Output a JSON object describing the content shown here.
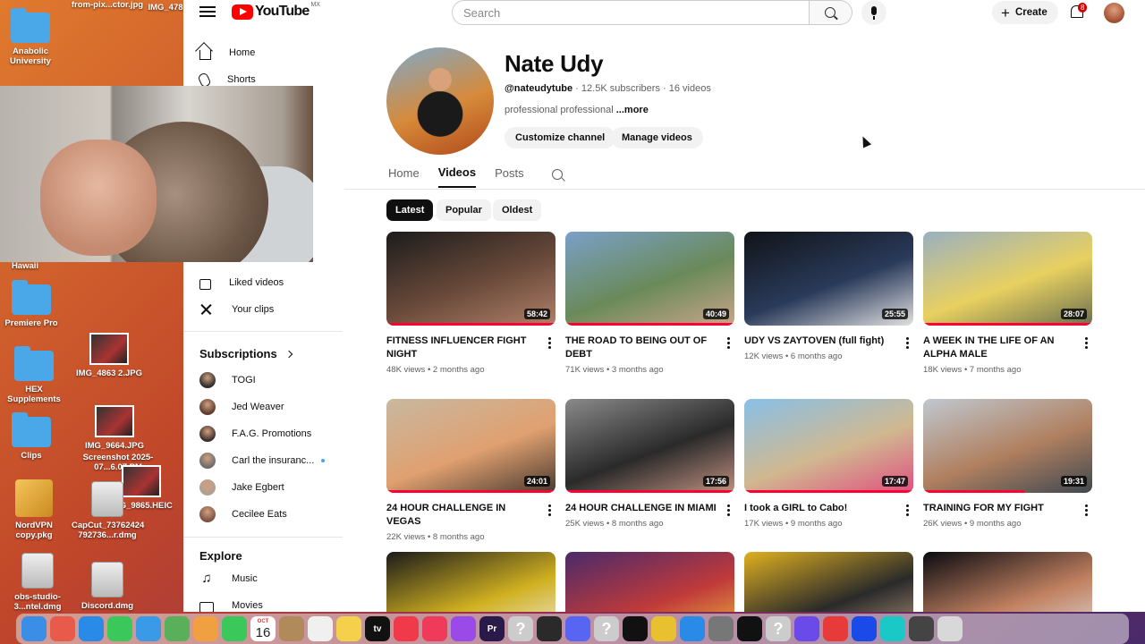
{
  "desktop": {
    "icons": [
      {
        "label": "from-pix...ctor.jpg",
        "kind": "photo"
      },
      {
        "label": "IMG_478",
        "kind": "photo"
      },
      {
        "label": "Anabolic University",
        "kind": "folder"
      },
      {
        "label": "Hawaii",
        "kind": "folder"
      },
      {
        "label": "Premiere Pro",
        "kind": "folder"
      },
      {
        "label": "IMG_4863 2.JPG",
        "kind": "photo"
      },
      {
        "label": "HEX Supplements",
        "kind": "folder"
      },
      {
        "label": "IMG_9664.JPG",
        "kind": "photo"
      },
      {
        "label": "Clips",
        "kind": "folder"
      },
      {
        "label": "Screenshot 2025-07...6.07 PM",
        "kind": "photo"
      },
      {
        "label": "IMG_9865.HEIC",
        "kind": "photo"
      },
      {
        "label": "NordVPN copy.pkg",
        "kind": "pkg"
      },
      {
        "label": "CapCut_73762424 792736...r.dmg",
        "kind": "disk"
      },
      {
        "label": "obs-studio-3...ntel.dmg",
        "kind": "disk"
      },
      {
        "label": "Discord.dmg",
        "kind": "disk"
      }
    ],
    "background_colors": [
      "#e07a2e",
      "#c0462a",
      "#8a2c52",
      "#4a2a6a"
    ]
  },
  "topbar": {
    "logo_text": "YouTube",
    "country_code": "MX",
    "search_placeholder": "Search",
    "create_label": "Create",
    "notification_count": "8"
  },
  "sidebar": {
    "items": [
      {
        "label": "Home",
        "icon": "home-icon"
      },
      {
        "label": "Shorts",
        "icon": "shorts-icon"
      },
      {
        "label": "Liked videos",
        "icon": "thumbs-up-icon"
      },
      {
        "label": "Your clips",
        "icon": "scissors-icon"
      }
    ],
    "subscriptions_title": "Subscriptions",
    "subscriptions": [
      {
        "label": "TOGI",
        "color": "#2a2a2a",
        "new": false
      },
      {
        "label": "Jed Weaver",
        "color": "#5a3a2a",
        "new": false
      },
      {
        "label": "F.A.G. Promotions",
        "color": "#3a2a2a",
        "new": false
      },
      {
        "label": "Carl the insuranc...",
        "color": "#6a6a6a",
        "new": true
      },
      {
        "label": "Jake Egbert",
        "color": "#b0a090",
        "new": false
      },
      {
        "label": "Cecilee Eats",
        "color": "#7a5040",
        "new": false
      }
    ],
    "explore_title": "Explore",
    "explore": [
      {
        "label": "Music",
        "icon": "music-note-icon"
      },
      {
        "label": "Movies",
        "icon": "film-icon"
      }
    ]
  },
  "channel": {
    "name": "Nate Udy",
    "handle": "@nateudytube",
    "subscribers": "12.5K subscribers",
    "video_count": "16 videos",
    "description": "professional professional",
    "more_label": "...more",
    "customize_label": "Customize channel",
    "manage_label": "Manage videos",
    "tabs": [
      "Home",
      "Videos",
      "Posts"
    ],
    "active_tab": "Videos",
    "filters": [
      "Latest",
      "Popular",
      "Oldest"
    ],
    "active_filter": "Latest"
  },
  "videos": [
    {
      "title": "FITNESS INFLUENCER FIGHT NIGHT",
      "duration": "58:42",
      "views": "48K views",
      "age": "2 months ago",
      "progress": 1.0,
      "colors": [
        "#1c1c1c",
        "#6a4a3a",
        "#b0806a"
      ]
    },
    {
      "title": "THE ROAD TO BEING OUT OF DEBT",
      "duration": "40:49",
      "views": "71K views",
      "age": "3 months ago",
      "progress": 1.0,
      "colors": [
        "#7aa0c8",
        "#6a8a5a",
        "#c9a58a"
      ]
    },
    {
      "title": "UDY VS ZAYTOVEN (full fight)",
      "duration": "25:55",
      "views": "12K views",
      "age": "6 months ago",
      "progress": 0.0,
      "colors": [
        "#101418",
        "#2a3a5a",
        "#e0e0e0"
      ]
    },
    {
      "title": "A WEEK IN THE LIFE OF AN ALPHA MALE",
      "duration": "28:07",
      "views": "18K views",
      "age": "7 months ago",
      "progress": 1.0,
      "colors": [
        "#9ab0c0",
        "#e8d060",
        "#6a7050"
      ]
    },
    {
      "title": "24 HOUR CHALLENGE IN VEGAS",
      "duration": "24:01",
      "views": "22K views",
      "age": "8 months ago",
      "progress": 1.0,
      "colors": [
        "#c8b8a0",
        "#e0a070",
        "#4a3a30"
      ]
    },
    {
      "title": "24 HOUR CHALLENGE IN MIAMI",
      "duration": "17:56",
      "views": "25K views",
      "age": "8 months ago",
      "progress": 1.0,
      "colors": [
        "#8a8a8a",
        "#2a2a2a",
        "#c09080"
      ]
    },
    {
      "title": "I took a GIRL to Cabo!",
      "duration": "17:47",
      "views": "17K views",
      "age": "9 months ago",
      "progress": 1.0,
      "colors": [
        "#88c0e8",
        "#d0b890",
        "#e05080"
      ]
    },
    {
      "title": "TRAINING FOR MY FIGHT",
      "duration": "19:31",
      "views": "26K views",
      "age": "9 months ago",
      "progress": 0.6,
      "colors": [
        "#c0c8d0",
        "#b08060",
        "#404850"
      ]
    },
    {
      "title": "",
      "duration": "",
      "views": "",
      "age": "",
      "progress": 0.0,
      "colors": [
        "#1a1a1a",
        "#d0b020",
        "#f0f0f0"
      ]
    },
    {
      "title": "",
      "duration": "",
      "views": "",
      "age": "",
      "progress": 0.0,
      "colors": [
        "#4a2a6a",
        "#c03a3a",
        "#f0c040"
      ]
    },
    {
      "title": "",
      "duration": "",
      "views": "",
      "age": "",
      "progress": 0.0,
      "colors": [
        "#e0b020",
        "#2a2a2a",
        "#c0a080"
      ]
    },
    {
      "title": "",
      "duration": "",
      "views": "",
      "age": "",
      "progress": 0.0,
      "colors": [
        "#0a0a10",
        "#c08060",
        "#e0e0e0"
      ]
    }
  ],
  "dock": {
    "calendar_day": "16",
    "calendar_month": "OCT",
    "apps": [
      {
        "name": "finder-icon",
        "color": "#3a8ee6"
      },
      {
        "name": "launchpad-icon",
        "color": "#e85a4a"
      },
      {
        "name": "safari-icon",
        "color": "#2a8ae8"
      },
      {
        "name": "messages-icon",
        "color": "#3ac85a",
        "badge": "355"
      },
      {
        "name": "mail-icon",
        "color": "#3a9ae8"
      },
      {
        "name": "maps-icon",
        "color": "#5ab05a"
      },
      {
        "name": "photos-icon",
        "color": "#f0a040"
      },
      {
        "name": "facetime-icon",
        "color": "#3ac85a",
        "badge": "2"
      },
      {
        "name": "calendar-icon",
        "color": "#ffffff"
      },
      {
        "name": "contacts-icon",
        "color": "#b08a5a"
      },
      {
        "name": "reminders-icon",
        "color": "#f0f0f0",
        "badge": "2"
      },
      {
        "name": "notes-icon",
        "color": "#f5d04a"
      },
      {
        "name": "tv-icon",
        "color": "#111111",
        "label": "tv"
      },
      {
        "name": "news-icon",
        "color": "#f03a4a"
      },
      {
        "name": "music-icon",
        "color": "#f03a5a"
      },
      {
        "name": "podcasts-icon",
        "color": "#9a4ae8"
      },
      {
        "name": "premiere-icon",
        "color": "#2a1a4a",
        "label": "Pr"
      },
      {
        "name": "unknown-app-icon",
        "color": "#cccccc",
        "label": "?"
      },
      {
        "name": "obs-icon",
        "color": "#2a2a2a"
      },
      {
        "name": "discord-icon",
        "color": "#5865f2"
      },
      {
        "name": "unknown-app-icon",
        "color": "#cccccc",
        "label": "?"
      },
      {
        "name": "capcut-icon",
        "color": "#111111"
      },
      {
        "name": "chrome-icon",
        "color": "#e8c030"
      },
      {
        "name": "app-store-icon",
        "color": "#2a8ae8"
      },
      {
        "name": "system-settings-icon",
        "color": "#777777"
      },
      {
        "name": "tiktok-icon",
        "color": "#111111"
      },
      {
        "name": "unknown-app-icon",
        "color": "#cccccc",
        "label": "?"
      },
      {
        "name": "proton-icon",
        "color": "#6a4ae8"
      },
      {
        "name": "creative-cloud-icon",
        "color": "#e83a3a"
      },
      {
        "name": "bitwarden-icon",
        "color": "#1a4ae8"
      },
      {
        "name": "surfshark-icon",
        "color": "#1ac8c8"
      },
      {
        "name": "downloads-icon",
        "color": "#444444"
      },
      {
        "name": "trash-icon",
        "color": "#d8d8d8"
      }
    ]
  }
}
